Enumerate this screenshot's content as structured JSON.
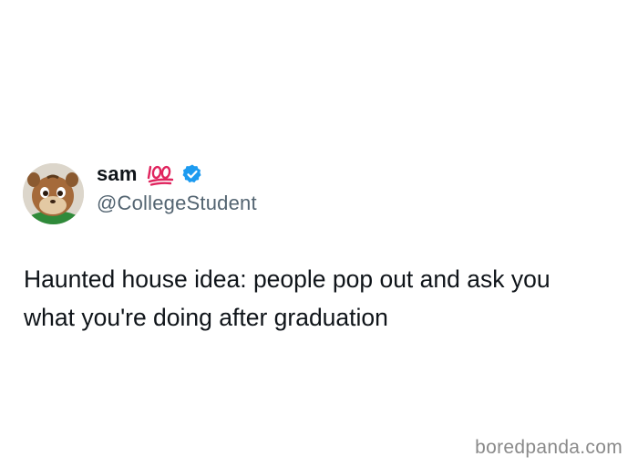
{
  "tweet": {
    "author": {
      "display_name": "sam",
      "badge_emoji_icon": "hundred-points-emoji-icon",
      "verified_icon": "verified-badge-icon",
      "handle": "@CollegeStudent",
      "avatar_icon": "chipmunk-avatar-icon"
    },
    "text": "Haunted house idea: people pop out and ask you what you're doing after graduation"
  },
  "watermark": {
    "text": "boredpanda.com"
  },
  "colors": {
    "background": "#ffffff",
    "text": "#0f1419",
    "handle": "#536471",
    "verified": "#1d9bf0",
    "emoji_red": "#e0245e",
    "watermark": "#8a8a8a"
  }
}
